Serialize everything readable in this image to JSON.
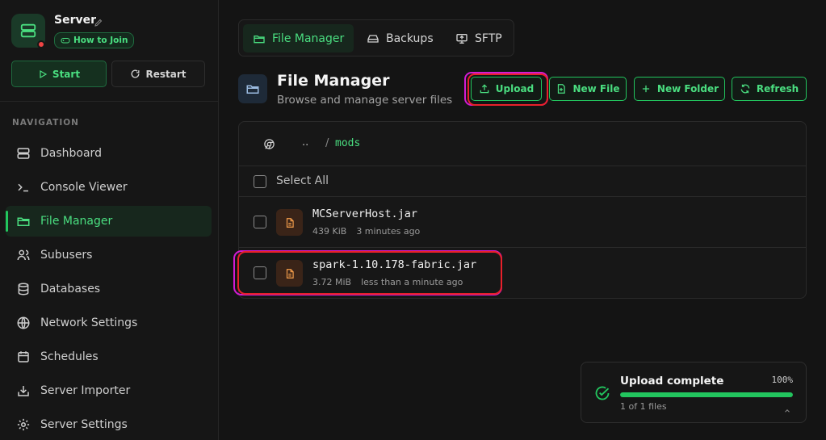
{
  "server": {
    "name": "Server",
    "how_to_join": "How to Join",
    "status_color": "#ef4444"
  },
  "controls": {
    "start": "Start",
    "restart": "Restart"
  },
  "nav": {
    "title": "NAVIGATION",
    "items": [
      {
        "label": "Dashboard",
        "icon": "server-icon"
      },
      {
        "label": "Console Viewer",
        "icon": "terminal-icon"
      },
      {
        "label": "File Manager",
        "icon": "folder-icon",
        "active": true
      },
      {
        "label": "Subusers",
        "icon": "users-icon"
      },
      {
        "label": "Databases",
        "icon": "database-icon"
      },
      {
        "label": "Network Settings",
        "icon": "globe-icon"
      },
      {
        "label": "Schedules",
        "icon": "calendar-icon"
      },
      {
        "label": "Server Importer",
        "icon": "import-icon"
      },
      {
        "label": "Server Settings",
        "icon": "gear-icon"
      }
    ]
  },
  "tabs": [
    {
      "label": "File Manager",
      "active": true
    },
    {
      "label": "Backups"
    },
    {
      "label": "SFTP"
    }
  ],
  "header": {
    "title": "File Manager",
    "subtitle": "Browse and manage server files"
  },
  "actions": {
    "upload": "Upload",
    "new_file": "New File",
    "new_folder": "New Folder",
    "refresh": "Refresh"
  },
  "breadcrumb": {
    "parent": "..",
    "separator": "/",
    "current": "mods"
  },
  "select_all": "Select All",
  "files": [
    {
      "name": "MCServerHost.jar",
      "size": "439 KiB",
      "modified": "3 minutes ago"
    },
    {
      "name": "spark-1.10.178-fabric.jar",
      "size": "3.72 MiB",
      "modified": "less than a minute ago"
    }
  ],
  "upload_toast": {
    "title": "Upload complete",
    "percent_label": "100%",
    "progress": 1.0,
    "count": "1 of 1 files"
  },
  "colors": {
    "accent": "#22c55e",
    "highlight_magenta": "#d31bd3",
    "highlight_red": "#e8202a"
  }
}
